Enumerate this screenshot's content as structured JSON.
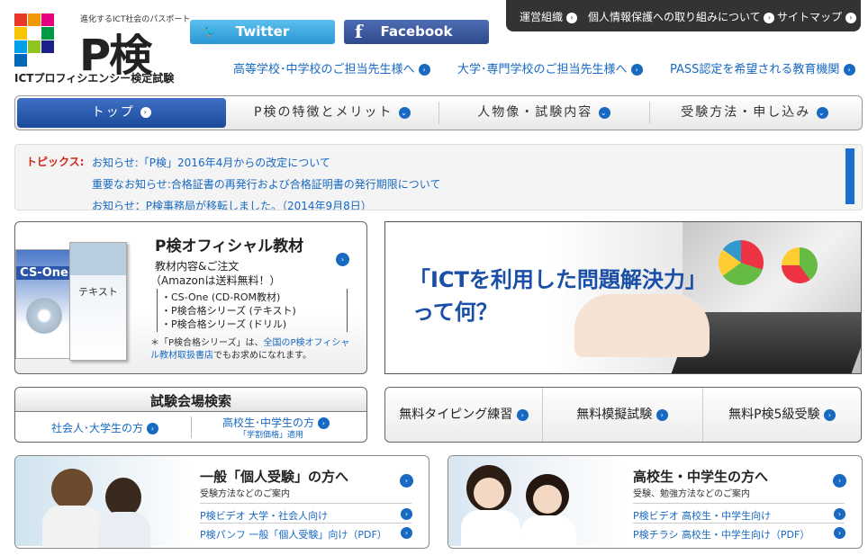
{
  "header": {
    "tagline": "進化するICT社会のパスポート",
    "logo_text": "P検",
    "logo_sub": "ICTプロフィシエンシー検定試験",
    "twitter": "Twitter",
    "facebook": "Facebook",
    "top_links": [
      "運営組織",
      "個人情報保護への取り組みについて",
      "サイトマップ"
    ],
    "audience_links": [
      "高等学校･中学校のご担当先生様へ",
      "大学･専門学校のご担当先生様へ",
      "PASS認定を希望される教育機関"
    ]
  },
  "nav": [
    "トップ",
    "P検の特徴とメリット",
    "人物像・試験内容",
    "受験方法・申し込み"
  ],
  "topics": {
    "label": "トピックス:",
    "items": [
      "お知らせ:「P検」2016年4月からの改定について",
      "重要なお知らせ:合格証書の再発行および合格証明書の発行期限について",
      "お知らせ：P検事務局が移転しました。（2014年9月8日）"
    ]
  },
  "official": {
    "title": "P検オフィシャル教材",
    "sub1": "教材内容&ご注文",
    "sub2": "（Amazonは送料無料！）",
    "list": [
      "・CS-One (CD-ROM教材)",
      "・P検合格シリーズ (テキスト)",
      "・P検合格シリーズ (ドリル)"
    ],
    "note_pre": "＊「P検合格シリーズ」は、",
    "note_link": "全国のP検オフィシャル教材取扱書店",
    "note_post": "でもお求めになれます。",
    "book1_label": "CS-One",
    "book2_label": "テキスト"
  },
  "ict": {
    "line1": "「ICTを利用した問題解決力」",
    "line2": "って何？"
  },
  "venue": {
    "title": "試験会場検索",
    "left": "社会人･大学生の方",
    "right": "高校生･中学生の方",
    "right_note": "「学割価格」適用"
  },
  "free": [
    "無料タイピング練習",
    "無料模擬試験",
    "無料P検5級受験"
  ],
  "individual": {
    "title": "一般「個人受験」の方へ",
    "sub": "受験方法などのご案内",
    "links": [
      "P検ビデオ 大学・社会人向け",
      "P検パンフ 一般「個人受験」向け（PDF）"
    ]
  },
  "students": {
    "title": "高校生・中学生の方へ",
    "sub": "受験、勉強方法などのご案内",
    "links": [
      "P検ビデオ 高校生・中学生向け",
      "P検チラシ 高校生・中学生向け（PDF）"
    ]
  },
  "colors": {
    "accent": "#1769c2",
    "twitter": "#3ea7e0",
    "facebook": "#3b5ba5",
    "nav_active": "#2a5bb0",
    "topic_label": "#d0271d"
  }
}
